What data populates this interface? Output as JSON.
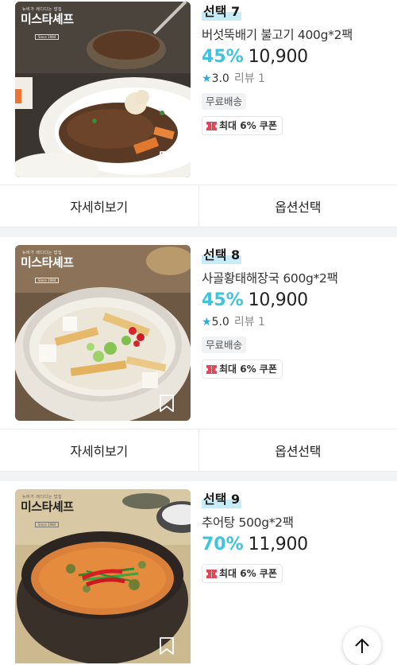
{
  "products": [
    {
      "badge": "선택 7",
      "title": "버섯뚝배기 불고기 400g*2팩",
      "discount": "45%",
      "price": "10,900",
      "rating": "3.0",
      "reviews": "리뷰 1",
      "shipping": "무료배송",
      "coupon": "최대 6% 쿠폰",
      "brand": {
        "tag": "뉴비가 레디디는 밥집",
        "name": "미스타셰프",
        "since": "Since 1984"
      }
    },
    {
      "badge": "선택 8",
      "title": "사골황태해장국 600g*2팩",
      "discount": "45%",
      "price": "10,900",
      "rating": "5.0",
      "reviews": "리뷰 1",
      "shipping": "무료배송",
      "coupon": "최대 6% 쿠폰",
      "brand": {
        "tag": "뉴비가 레디디는 밥집",
        "name": "미스타셰프",
        "since": "Since 1984"
      }
    },
    {
      "badge": "선택 9",
      "title": "추어탕 500g*2팩",
      "discount": "70%",
      "price": "11,900",
      "coupon": "최대 6% 쿠폰",
      "brand": {
        "tag": "뉴비가 레디디는 밥집",
        "name": "미스타셰프",
        "since": "Since 1984"
      }
    }
  ],
  "buttons": {
    "detail": "자세히보기",
    "option": "옵션선택"
  },
  "icons": {
    "star": "star-icon",
    "coupon": "coupon-icon",
    "bookmark": "bookmark-icon",
    "scroll_top": "arrow-up-icon"
  },
  "colors": {
    "accent": "#3cc5dd",
    "badge_highlight": "#c7ecf7",
    "star": "#30a9dc",
    "coupon_icon": "#e0485a"
  }
}
